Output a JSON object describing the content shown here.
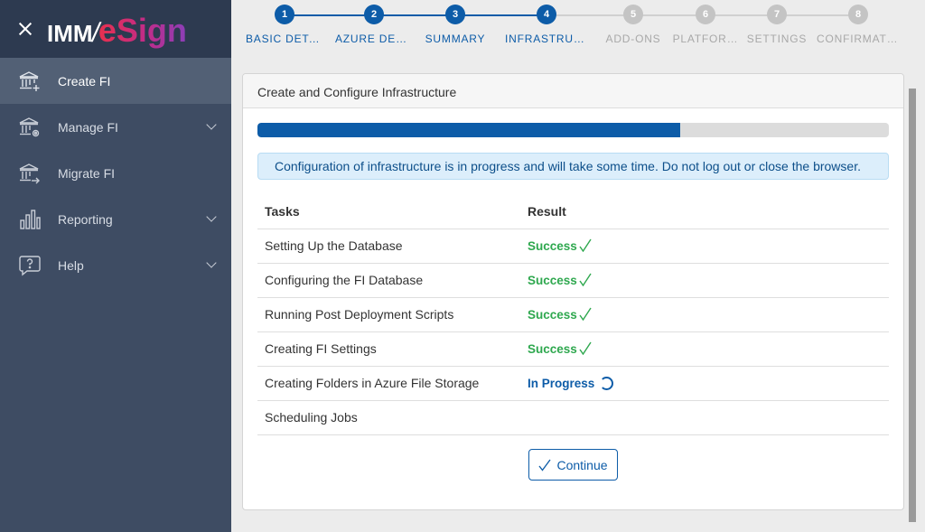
{
  "brand": {
    "logo_prefix": "IMM",
    "logo_slash": "/",
    "logo_name": "eSign"
  },
  "sidebar": {
    "items": [
      {
        "label": "Create FI",
        "icon": "bank-plus-icon",
        "active": true,
        "expandable": false
      },
      {
        "label": "Manage FI",
        "icon": "bank-gear-icon",
        "active": false,
        "expandable": true
      },
      {
        "label": "Migrate FI",
        "icon": "bank-arrow-icon",
        "active": false,
        "expandable": false
      },
      {
        "label": "Reporting",
        "icon": "bar-chart-icon",
        "active": false,
        "expandable": true
      },
      {
        "label": "Help",
        "icon": "help-icon",
        "active": false,
        "expandable": true
      }
    ]
  },
  "stepper": {
    "steps": [
      {
        "num": "1",
        "label": "BASIC DETA…",
        "state": "done"
      },
      {
        "num": "2",
        "label": "AZURE DETA…",
        "state": "done"
      },
      {
        "num": "3",
        "label": "SUMMARY",
        "state": "done"
      },
      {
        "num": "4",
        "label": "INFRASTRUCT…",
        "state": "done"
      },
      {
        "num": "5",
        "label": "ADD-ONS",
        "state": "todo"
      },
      {
        "num": "6",
        "label": "PLATFOR…",
        "state": "todo"
      },
      {
        "num": "7",
        "label": "SETTINGS",
        "state": "todo"
      },
      {
        "num": "8",
        "label": "CONFIRMATI…",
        "state": "todo"
      }
    ]
  },
  "card": {
    "title": "Create and Configure Infrastructure",
    "progress_fraction": 0.67,
    "alert": "Configuration of infrastructure is in progress and will take some time. Do not log out or close the browser.",
    "table": {
      "headers": [
        "Tasks",
        "Result"
      ],
      "rows": [
        {
          "task": "Setting Up the Database",
          "result": "Success",
          "status": "success"
        },
        {
          "task": "Configuring the FI Database",
          "result": "Success",
          "status": "success"
        },
        {
          "task": "Running Post Deployment Scripts",
          "result": "Success",
          "status": "success"
        },
        {
          "task": "Creating FI Settings",
          "result": "Success",
          "status": "success"
        },
        {
          "task": "Creating Folders in Azure File Storage",
          "result": "In Progress",
          "status": "progress"
        },
        {
          "task": "Scheduling Jobs",
          "result": "",
          "status": "pending"
        }
      ]
    },
    "continue_label": "Continue"
  },
  "colors": {
    "primary": "#0d5ca8",
    "success": "#2fa84f",
    "sidebar": "#3e4c63",
    "sidebar_active": "#526075",
    "step_inactive": "#c4c4c4"
  }
}
